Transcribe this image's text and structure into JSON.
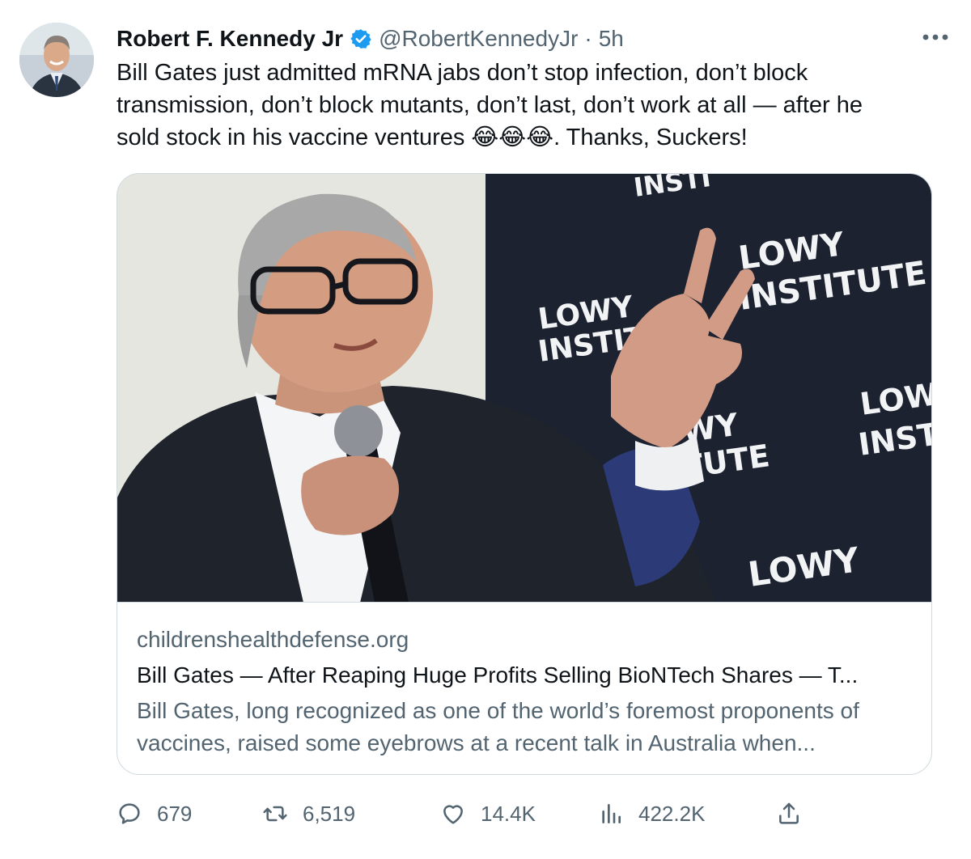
{
  "tweet": {
    "author": {
      "name": "Robert F. Kennedy Jr",
      "handle": "@RobertKennedyJr",
      "separator": "·",
      "time": "5h",
      "verified": true,
      "verified_color": "#1d9bf0"
    },
    "text": "Bill Gates just admitted mRNA jabs don’t stop infection, don’t block\ntransmission, don’t block mutants, don’t last, don’t work at all — after he\nsold stock in his vaccine ventures 😂😂😂. Thanks, Suckers!",
    "card": {
      "image_text": {
        "sign_top": "INSTI",
        "sign_left_1": "LOWY",
        "sign_left_2": "INSTIT",
        "sign_main_1": "LOWY",
        "sign_main_2": "INSTITUTE",
        "sign_right_1": "LOW",
        "sign_right_2": "INST",
        "sign_mid_1": "WY",
        "sign_mid_2": "TUTE",
        "sign_bottom": "LOWY"
      },
      "domain": "childrenshealthdefense.org",
      "title": "Bill Gates — After Reaping Huge Profits Selling BioNTech Shares — T...",
      "description": "Bill Gates, long recognized as one of the world’s foremost proponents of vaccines, raised some eyebrows at a recent talk in Australia when..."
    },
    "actions": {
      "reply_icon": "reply-icon",
      "replies": "679",
      "retweet_icon": "retweet-icon",
      "retweets": "6,519",
      "like_icon": "like-icon",
      "likes": "14.4K",
      "views_icon": "views-icon",
      "views": "422.2K",
      "share_icon": "share-icon"
    },
    "colors": {
      "text": "#0f1419",
      "secondary": "#536471",
      "border": "#cfd9de",
      "accent": "#1d9bf0"
    }
  }
}
